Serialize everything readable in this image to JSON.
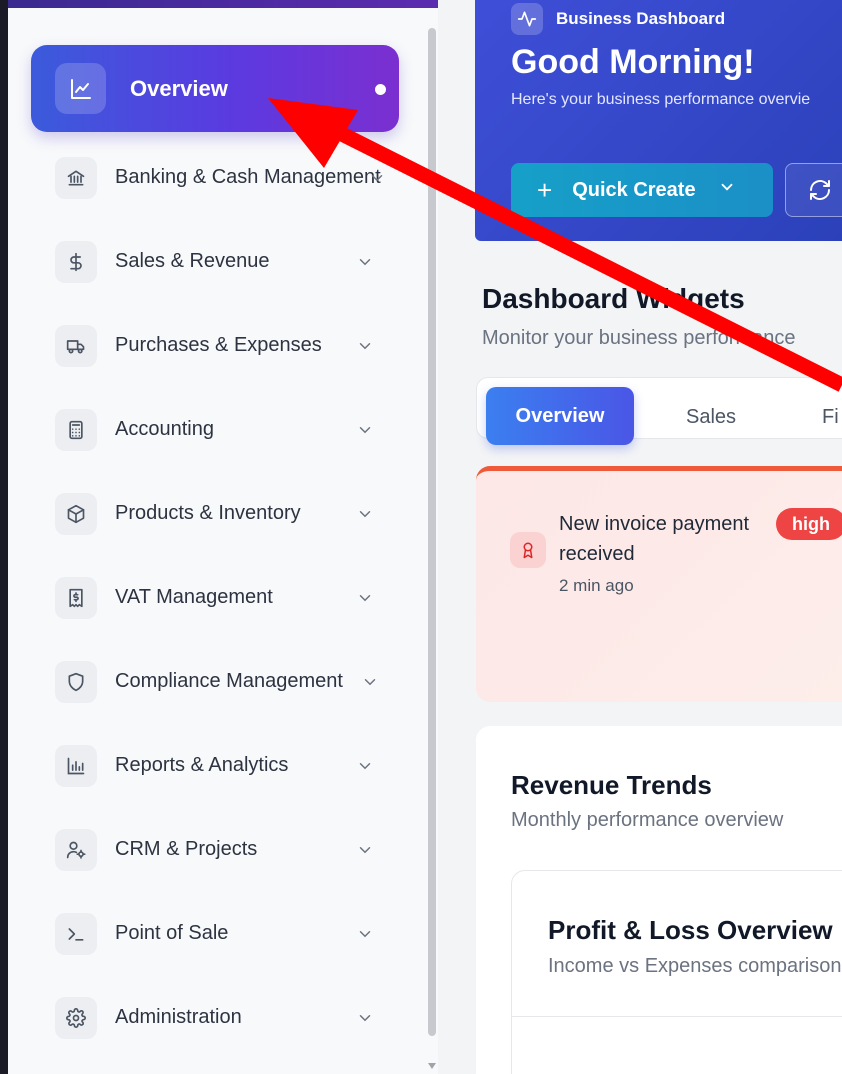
{
  "sidebar": {
    "active": {
      "label": "Overview",
      "icon": "line-chart-icon"
    },
    "items": [
      {
        "label": "Banking & Cash Management",
        "icon": "bank-icon"
      },
      {
        "label": "Sales & Revenue",
        "icon": "dollar-icon"
      },
      {
        "label": "Purchases & Expenses",
        "icon": "truck-icon"
      },
      {
        "label": "Accounting",
        "icon": "calculator-icon"
      },
      {
        "label": "Products & Inventory",
        "icon": "box-icon"
      },
      {
        "label": "VAT Management",
        "icon": "receipt-icon"
      },
      {
        "label": "Compliance Management",
        "icon": "shield-icon"
      },
      {
        "label": "Reports & Analytics",
        "icon": "bar-chart-icon"
      },
      {
        "label": "CRM & Projects",
        "icon": "user-gear-icon"
      },
      {
        "label": "Point of Sale",
        "icon": "terminal-icon"
      },
      {
        "label": "Administration",
        "icon": "gear-icon"
      }
    ]
  },
  "hero": {
    "badge": "Business Dashboard",
    "title": "Good Morning!",
    "description": "Here's your business performance overvie",
    "quick_create": "Quick Create"
  },
  "widgets": {
    "title": "Dashboard Widgets",
    "subtitle": "Monitor your business performance",
    "tabs": [
      "Overview",
      "Sales",
      "Fi"
    ]
  },
  "alert": {
    "title": "New invoice payment received",
    "time": "2 min ago",
    "priority": "high"
  },
  "revenue": {
    "title": "Revenue Trends",
    "subtitle": "Monthly performance overview",
    "pl_title": "Profit & Loss Overview",
    "pl_subtitle": "Income vs Expenses comparison"
  },
  "colors": {
    "accent": "#4f46e5",
    "annotation_arrow": "#ff0000",
    "priority_high": "#ef4444"
  }
}
